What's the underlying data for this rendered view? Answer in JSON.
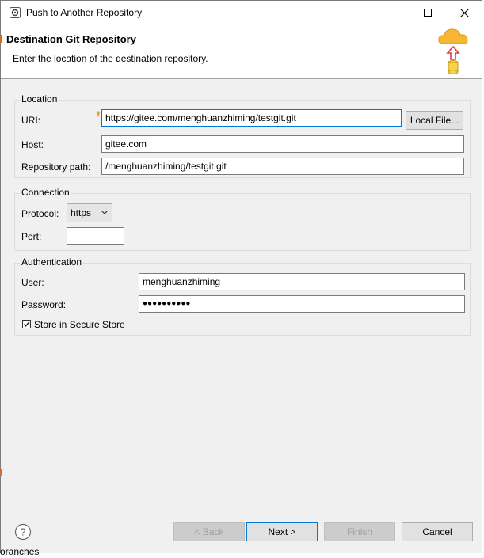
{
  "window": {
    "title": "Push to Another Repository",
    "title_icon": "eclipse-gear-icon"
  },
  "banner": {
    "title": "Destination Git Repository",
    "subtitle": "Enter the location of the destination repository.",
    "icon": "cloud-push-icon"
  },
  "location": {
    "group_label": "Location",
    "uri_label": "URI:",
    "uri_value": "https://gitee.com/menghuanzhiming/testgit.git",
    "local_file_button": "Local File...",
    "host_label": "Host:",
    "host_value": "gitee.com",
    "repo_path_label": "Repository path:",
    "repo_path_value": "/menghuanzhiming/testgit.git"
  },
  "connection": {
    "group_label": "Connection",
    "protocol_label": "Protocol:",
    "protocol_value": "https",
    "port_label": "Port:",
    "port_value": ""
  },
  "authentication": {
    "group_label": "Authentication",
    "user_label": "User:",
    "user_value": "menghuanzhiming",
    "password_label": "Password:",
    "password_value": "●●●●●●●●●●",
    "store_label": "Store in Secure Store",
    "store_checked": true
  },
  "footer": {
    "back": "< Back",
    "next": "Next >",
    "finish": "Finish",
    "cancel": "Cancel"
  },
  "background": {
    "partial_text": "oranches"
  },
  "colors": {
    "focus": "#0078d7",
    "content_bg": "#f0f0f0",
    "cloud": "#f5b731",
    "arrow": "#e0393e"
  }
}
